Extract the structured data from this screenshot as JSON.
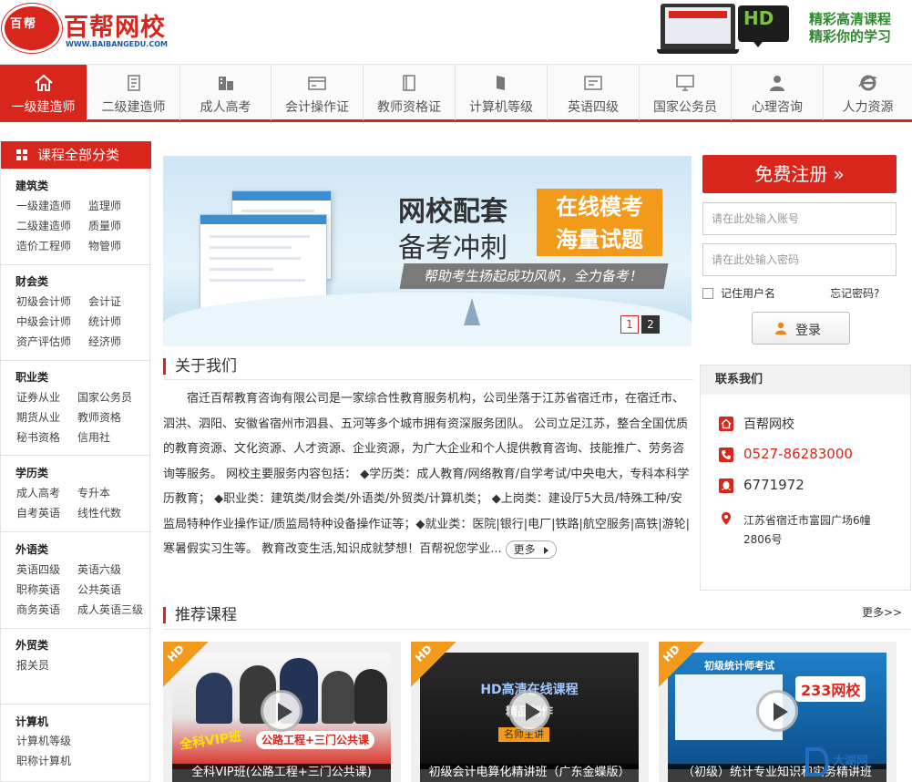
{
  "header": {
    "logo_seal_text": "百帮",
    "logo_text": "百帮网校",
    "logo_url": "WWW.BAIBANGEDU.COM",
    "hd_badge": "HD",
    "slogan_line1": "精彩高清课程",
    "slogan_line2": "精彩你的学习"
  },
  "nav": {
    "items": [
      {
        "label": "一级建造师",
        "icon": "home-icon",
        "active": true
      },
      {
        "label": "二级建造师",
        "icon": "document-icon"
      },
      {
        "label": "成人高考",
        "icon": "building-icon"
      },
      {
        "label": "会计操作证",
        "icon": "card-icon"
      },
      {
        "label": "教师资格证",
        "icon": "book-icon"
      },
      {
        "label": "计算机等级",
        "icon": "phone-icon"
      },
      {
        "label": "英语四级",
        "icon": "chat-icon"
      },
      {
        "label": "国家公务员",
        "icon": "monitor-icon"
      },
      {
        "label": "心理咨询",
        "icon": "person-icon"
      },
      {
        "label": "人力资源",
        "icon": "ie-icon"
      }
    ]
  },
  "sidebar": {
    "title": "课程全部分类",
    "groups": [
      {
        "title": "建筑类",
        "links": [
          "一级建造师",
          "监理师",
          "二级建造师",
          "质量师",
          "造价工程师",
          "物管师"
        ]
      },
      {
        "title": "财会类",
        "links": [
          "初级会计师",
          "会计证",
          "中级会计师",
          "统计师",
          "资产评估师",
          "经济师"
        ]
      },
      {
        "title": "职业类",
        "links": [
          "证券从业",
          "国家公务员",
          "期货从业",
          "教师资格",
          "秘书资格",
          "信用社"
        ]
      },
      {
        "title": "学历类",
        "links": [
          "成人高考",
          "专升本",
          "自考英语",
          "线性代数"
        ]
      },
      {
        "title": "外语类",
        "links": [
          "英语四级",
          "英语六级",
          "职称英语",
          "公共英语",
          "商务英语",
          "成人英语三级"
        ]
      },
      {
        "title": "外贸类",
        "links": [
          "报关员"
        ]
      },
      {
        "title": "计算机",
        "links": [
          "计算机等级",
          "职称计算机"
        ]
      }
    ]
  },
  "banner": {
    "title1": "网校配套",
    "title2": "备考冲刺",
    "box_line1": "在线模考",
    "box_line2": "海量试题",
    "subtitle": "帮助考生扬起成功风帆，全力备考！",
    "page1": "1",
    "page2": "2"
  },
  "login": {
    "register_label": "免费注册 »",
    "account_placeholder": "请在此处输入账号",
    "password_placeholder": "请在此处输入密码",
    "remember_label": "记住用户名",
    "forgot_label": "忘记密码?",
    "login_label": "登录"
  },
  "about": {
    "title": "关于我们",
    "text": "宿迁百帮教育咨询有限公司是一家综合性教育服务机构，公司坐落于江苏省宿迁市，在宿迁市、泗洪、泗阳、安徽省宿州市泗县、五河等多个城市拥有资深服务团队。 公司立足江苏，整合全国优质的教育资源、文化资源、人才资源、企业资源，为广大企业和个人提供教育咨询、技能推广、劳务咨询等服务。 网校主要服务内容包括： ◆学历类：成人教育/网络教育/自学考试/中央电大，专科本科学历教育； ◆职业类：建筑类/财会类/外语类/外贸类/计算机类； ◆上岗类：建设厅5大员/特殊工种/安监局特种作业操作证/质监局特种设备操作证等；◆就业类：医院|银行|电厂|铁路|航空服务|高铁|游轮|寒暑假实习生等。 教育改变生活,知识成就梦想！百帮祝您学业...",
    "more_label": "更多"
  },
  "contact": {
    "title": "联系我们",
    "name": "百帮网校",
    "phone": "0527-86283000",
    "qq": "6771972",
    "address": "江苏省宿迁市富园广场6幢2806号",
    "accent": "#d9261c"
  },
  "courses": {
    "title": "推荐课程",
    "more_label": "更多>>",
    "items": [
      {
        "caption": "全科VIP班(公路工程+三门公共课)",
        "badge": "HD",
        "vip_text": "全科VIP班",
        "sub_text": "公路工程+三门公共课"
      },
      {
        "caption": "初级会计电算化精讲班（广东金蝶版）",
        "badge": "HD",
        "thumb_title": "HD高清在线课程",
        "thumb_sub": "精品制作",
        "thumb_tag": "名师主讲"
      },
      {
        "caption": "（初级）统计专业知识和实务精讲班",
        "badge": "HD",
        "thumb_title": "初级统计师考试",
        "thumb_brand": "233网校"
      }
    ]
  },
  "watermark": "大湖网"
}
